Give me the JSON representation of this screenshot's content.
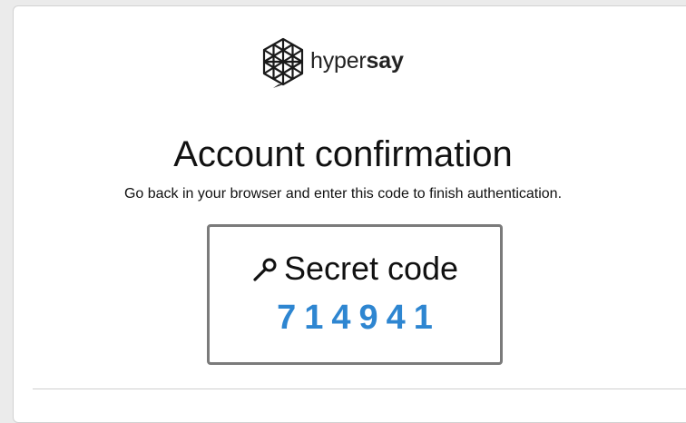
{
  "brand": {
    "name_prefix": "hyper",
    "name_suffix": "say"
  },
  "page": {
    "title": "Account confirmation",
    "instructions": "Go back in your browser and enter this code to finish authentication."
  },
  "code": {
    "icon": "key-icon",
    "label": "Secret code",
    "value": "714941"
  },
  "colors": {
    "code_value": "#2e86d1",
    "code_box_border": "#7b7b7b"
  }
}
